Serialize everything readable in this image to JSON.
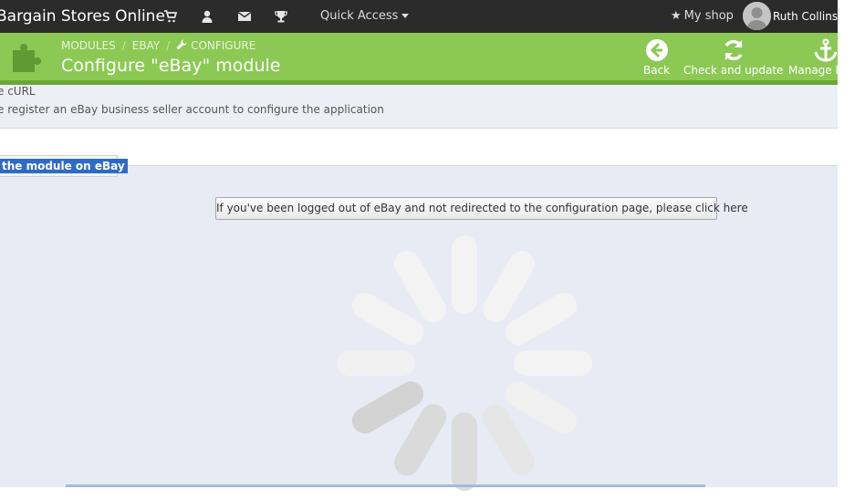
{
  "header": {
    "shop_name": "Bargain Stores Online",
    "icons": [
      "cart-icon",
      "user-icon",
      "envelope-icon",
      "trophy-icon"
    ],
    "quick_access": "Quick Access",
    "my_shop": "My shop",
    "user_name": "Ruth Collinson"
  },
  "toolbar": {
    "breadcrumb": [
      "MODULES",
      "EBAY",
      "CONFIGURE"
    ],
    "breadcrumb_sep": "/",
    "title": "Configure \"eBay\" module",
    "buttons": [
      {
        "label": "Back",
        "icon": "arrow-left-circle-icon"
      },
      {
        "label": "Check and update",
        "icon": "refresh-icon"
      },
      {
        "label": "Manage h",
        "icon": "anchor-icon"
      }
    ]
  },
  "info": {
    "line1": "e cURL",
    "line2": "e register an eBay business seller account to configure the application"
  },
  "tab": {
    "label": " the module on eBay"
  },
  "main": {
    "redirect_button": "If you've been logged out of eBay and not redirected to the configuration page, please click here",
    "spinner": "loading-spinner-icon"
  },
  "colors": {
    "topbar": "#2b2b2b",
    "toolbar_green": "#8bc954",
    "panel": "#e8ebf3",
    "selection": "#2f6bc4"
  }
}
